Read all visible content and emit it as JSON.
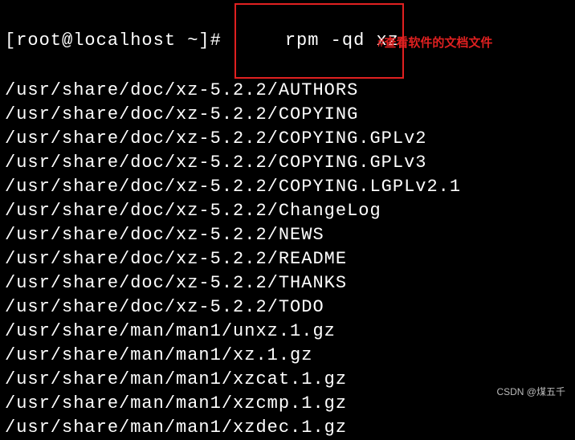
{
  "prompt": {
    "user_host": "[root@localhost ~]# ",
    "command": "rpm -qd xz"
  },
  "annotation": "#查看软件的文档文件",
  "output": [
    "/usr/share/doc/xz-5.2.2/AUTHORS",
    "/usr/share/doc/xz-5.2.2/COPYING",
    "/usr/share/doc/xz-5.2.2/COPYING.GPLv2",
    "/usr/share/doc/xz-5.2.2/COPYING.GPLv3",
    "/usr/share/doc/xz-5.2.2/COPYING.LGPLv2.1",
    "/usr/share/doc/xz-5.2.2/ChangeLog",
    "/usr/share/doc/xz-5.2.2/NEWS",
    "/usr/share/doc/xz-5.2.2/README",
    "/usr/share/doc/xz-5.2.2/THANKS",
    "/usr/share/doc/xz-5.2.2/TODO",
    "/usr/share/man/man1/unxz.1.gz",
    "/usr/share/man/man1/xz.1.gz",
    "/usr/share/man/man1/xzcat.1.gz",
    "/usr/share/man/man1/xzcmp.1.gz",
    "/usr/share/man/man1/xzdec.1.gz"
  ],
  "watermark": "CSDN @煤五千"
}
